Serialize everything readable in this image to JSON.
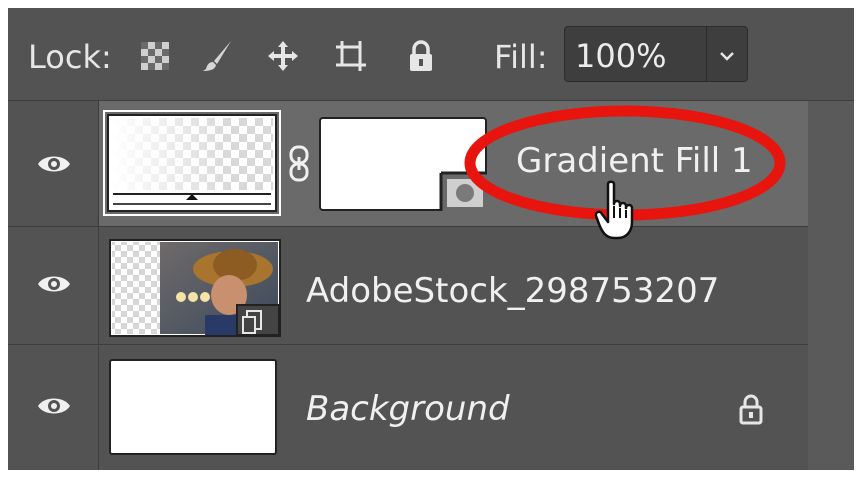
{
  "lock": {
    "label": "Lock:",
    "icons": [
      "lock-transparent-pixels-icon",
      "lock-image-pixels-icon",
      "lock-position-icon",
      "lock-artboard-icon",
      "lock-all-icon"
    ]
  },
  "fill": {
    "label": "Fill:",
    "value": "100%"
  },
  "layers": [
    {
      "name": "Gradient Fill 1",
      "selected": true,
      "type": "gradient-fill"
    },
    {
      "name": "AdobeStock_298753207",
      "selected": false,
      "type": "smart-object"
    },
    {
      "name": "Background",
      "selected": false,
      "type": "background",
      "locked": true
    }
  ],
  "colors": {
    "panel": "#535353",
    "selected_row": "#6a6a6a",
    "annotation": "#e8150f"
  }
}
